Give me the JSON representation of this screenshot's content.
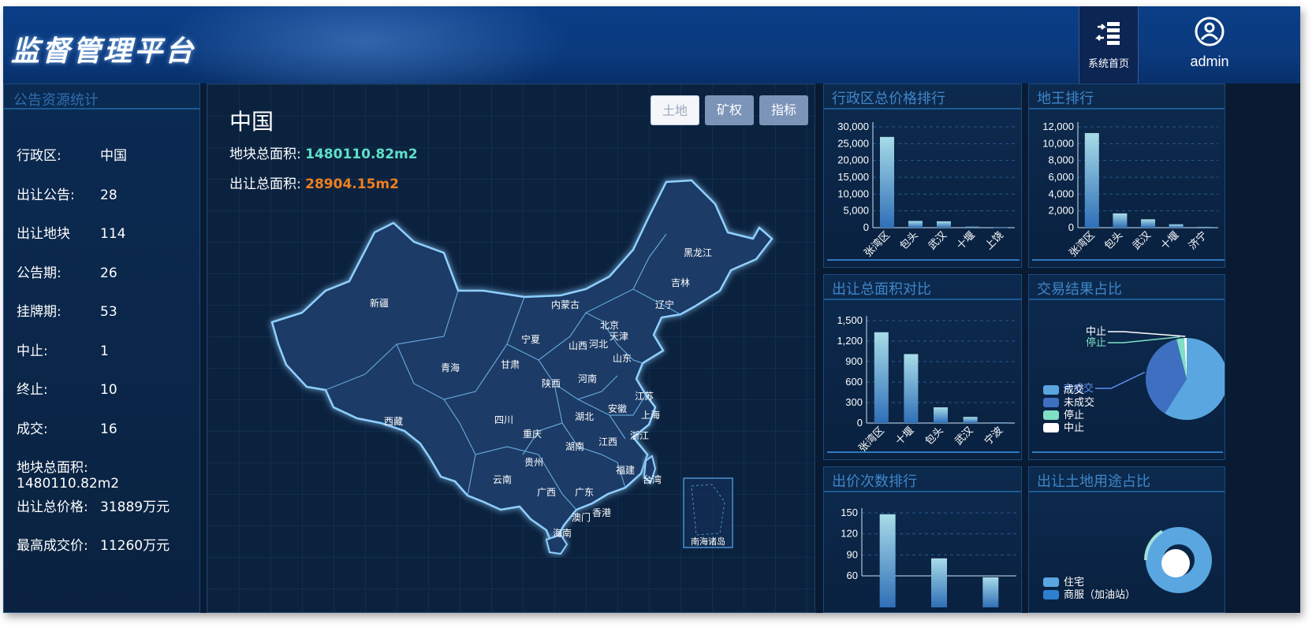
{
  "header": {
    "app_title": "监督管理平台",
    "home_label": "系统首页",
    "user_name": "admin"
  },
  "left": {
    "title": "公告资源统计",
    "stats": [
      {
        "key": "行政区:",
        "value": "中国"
      },
      {
        "key": "出让公告:",
        "value": "28"
      },
      {
        "key": "出让地块",
        "value": "114"
      },
      {
        "key": "公告期:",
        "value": "26"
      },
      {
        "key": "挂牌期:",
        "value": "53"
      },
      {
        "key": "中止:",
        "value": "1"
      },
      {
        "key": "终止:",
        "value": "10"
      },
      {
        "key": "成交:",
        "value": "16"
      },
      {
        "key": "地块总面积:",
        "value": "1480110.82m2"
      },
      {
        "key": "出让总价格:",
        "value": "31889万元"
      },
      {
        "key": "最高成交价:",
        "value": "11260万元"
      }
    ]
  },
  "map": {
    "country": "中国",
    "land_area_label": "地块总面积:",
    "land_area_value": "1480110.82m2",
    "sale_area_label": "出让总面积:",
    "sale_area_value": "28904.15m2",
    "tabs": [
      "土地",
      "矿权",
      "指标"
    ],
    "inset_label": "南海诸岛",
    "provinces": [
      "新疆",
      "西藏",
      "青海",
      "甘肃",
      "宁夏",
      "内蒙古",
      "黑龙江",
      "吉林",
      "辽宁",
      "北京",
      "天津",
      "河北",
      "山西",
      "山东",
      "陕西",
      "河南",
      "四川",
      "重庆",
      "湖北",
      "安徽",
      "江苏",
      "上海",
      "浙江",
      "湖南",
      "江西",
      "贵州",
      "云南",
      "广西",
      "广东",
      "福建",
      "台湾",
      "澳门",
      "香港",
      "海南"
    ]
  },
  "colors": {
    "bar_top": "#a8dce8",
    "bar_bottom": "#2f6fb7",
    "map_fill": "#1f3a66",
    "map_stroke": "#7cc0f0"
  },
  "charts": {
    "region_price": {
      "title": "行政区总价格排行",
      "chart_data": {
        "type": "bar",
        "categories": [
          "张湾区",
          "包头",
          "武汉",
          "十堰",
          "上饶"
        ],
        "values": [
          27000,
          2000,
          1900,
          300,
          100
        ],
        "yticks": [
          "30,000",
          "25,000",
          "20,000",
          "15,000",
          "10,000",
          "5,000",
          "0"
        ],
        "ylim": [
          0,
          30000
        ]
      }
    },
    "land_king": {
      "title": "地王排行",
      "chart_data": {
        "type": "bar",
        "categories": [
          "张湾区",
          "包头",
          "武汉",
          "十堰",
          "济宁"
        ],
        "values": [
          11260,
          1700,
          1000,
          400,
          100
        ],
        "yticks": [
          "12,000",
          "10,000",
          "8,000",
          "6,000",
          "4,000",
          "2,000",
          "0"
        ],
        "ylim": [
          0,
          12000
        ]
      }
    },
    "sale_area": {
      "title": "出让总面积对比",
      "chart_data": {
        "type": "bar",
        "categories": [
          "张湾区",
          "十堰",
          "包头",
          "武汉",
          "宁波"
        ],
        "values": [
          1330,
          1010,
          230,
          90,
          10
        ],
        "yticks": [
          "1,500",
          "1,200",
          "900",
          "600",
          "300",
          "0"
        ],
        "ylim": [
          0,
          1500
        ]
      }
    },
    "trade_result": {
      "title": "交易结果占比",
      "chart_data": {
        "type": "pie",
        "labels": [
          "成交",
          "未成交",
          "停止",
          "中止"
        ],
        "values": [
          59,
          37,
          3,
          1
        ],
        "colors": [
          "#5aa6e0",
          "#3f6fc0",
          "#7fe0c4",
          "#ffffff"
        ]
      },
      "callouts": [
        "中止",
        "停止",
        "未成交",
        "成"
      ]
    },
    "bid_count": {
      "title": "出价次数排行",
      "chart_data": {
        "type": "bar",
        "categories": [
          "",
          "",
          ""
        ],
        "values": [
          148,
          85,
          58
        ],
        "yticks": [
          "150",
          "120",
          "90",
          "60"
        ],
        "ylim": [
          0,
          150
        ]
      }
    },
    "land_use": {
      "title": "出让土地用途占比",
      "chart_data": {
        "type": "pie",
        "labels": [
          "住宅",
          "商服（加油站）"
        ],
        "colors": [
          "#5aa6e0",
          "#2f7fd0"
        ]
      }
    }
  }
}
